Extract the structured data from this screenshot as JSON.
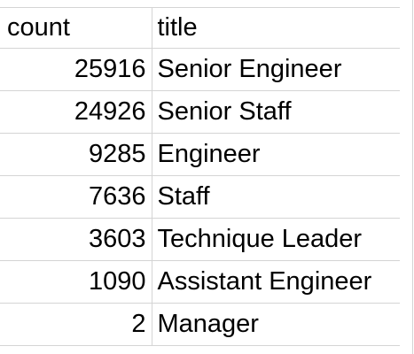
{
  "sheet": {
    "headers": [
      "count",
      "title"
    ],
    "rows": [
      {
        "count": "25916",
        "title": "Senior Engineer"
      },
      {
        "count": "24926",
        "title": "Senior Staff"
      },
      {
        "count": "9285",
        "title": "Engineer"
      },
      {
        "count": "7636",
        "title": "Staff"
      },
      {
        "count": "3603",
        "title": "Technique Leader"
      },
      {
        "count": "1090",
        "title": "Assistant Engineer"
      },
      {
        "count": "2",
        "title": "Manager"
      }
    ]
  },
  "colors": {
    "gridline": "#d4d4d4",
    "text": "#000000",
    "background": "#ffffff"
  }
}
